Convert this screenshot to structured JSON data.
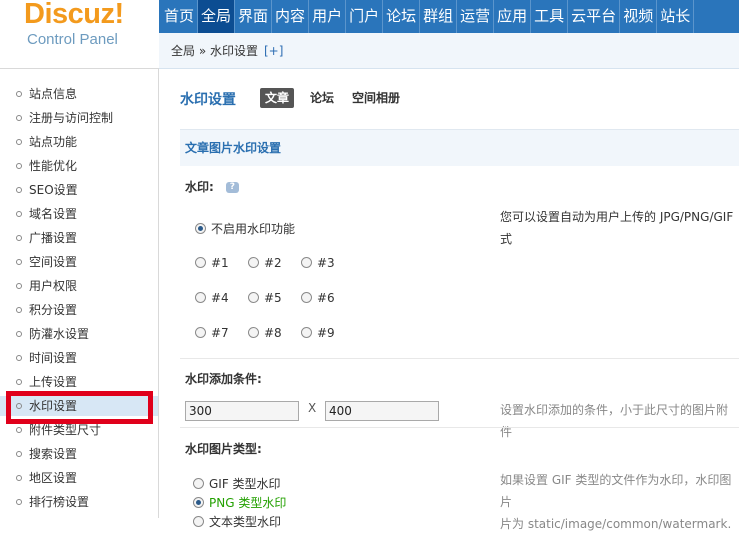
{
  "logo": {
    "brand": "Discuz!",
    "subtitle": "Control Panel"
  },
  "topnav": [
    "首页",
    "全局",
    "界面",
    "内容",
    "用户",
    "门户",
    "论坛",
    "群组",
    "运营",
    "应用",
    "工具",
    "云平台",
    "视频",
    "站长"
  ],
  "topnav_active": "全局",
  "breadcrumb": {
    "path": "全局 » 水印设置",
    "add": "[+]"
  },
  "sidebar": {
    "items": [
      "站点信息",
      "注册与访问控制",
      "站点功能",
      "性能优化",
      "SEO设置",
      "域名设置",
      "广播设置",
      "空间设置",
      "用户权限",
      "积分设置",
      "防灌水设置",
      "时间设置",
      "上传设置",
      "水印设置",
      "附件类型尺寸",
      "搜索设置",
      "地区设置",
      "排行榜设置"
    ],
    "active": "水印设置"
  },
  "page": {
    "title": "水印设置",
    "tabs": [
      "文章",
      "论坛",
      "空间相册"
    ],
    "active_tab": "文章"
  },
  "section": {
    "title": "文章图片水印设置"
  },
  "watermark": {
    "label": "水印:",
    "help_icon": "?",
    "disable": "不启用水印功能",
    "positions": [
      "#1",
      "#2",
      "#3",
      "#4",
      "#5",
      "#6",
      "#7",
      "#8",
      "#9"
    ],
    "hint_line1": "您可以设置自动为用户上传的 JPG/PNG/GIF",
    "hint_line2": "式"
  },
  "condition": {
    "label": "水印添加条件:",
    "width": "300",
    "x": "X",
    "height": "400",
    "hint": "设置水印添加的条件，小于此尺寸的图片附件"
  },
  "type": {
    "label": "水印图片类型:",
    "options": [
      "GIF 类型水印",
      "PNG 类型水印",
      "文本类型水印"
    ],
    "selected": "PNG 类型水印",
    "hint_line1": "如果设置 GIF 类型的文件作为水印，水印图片",
    "hint_line2": "片为 static/image/common/watermark."
  },
  "colors": {
    "nav": "#2a75bb",
    "accent": "#2a6fb0",
    "highlight": "#e0001b",
    "logo": "#f39a1d"
  }
}
